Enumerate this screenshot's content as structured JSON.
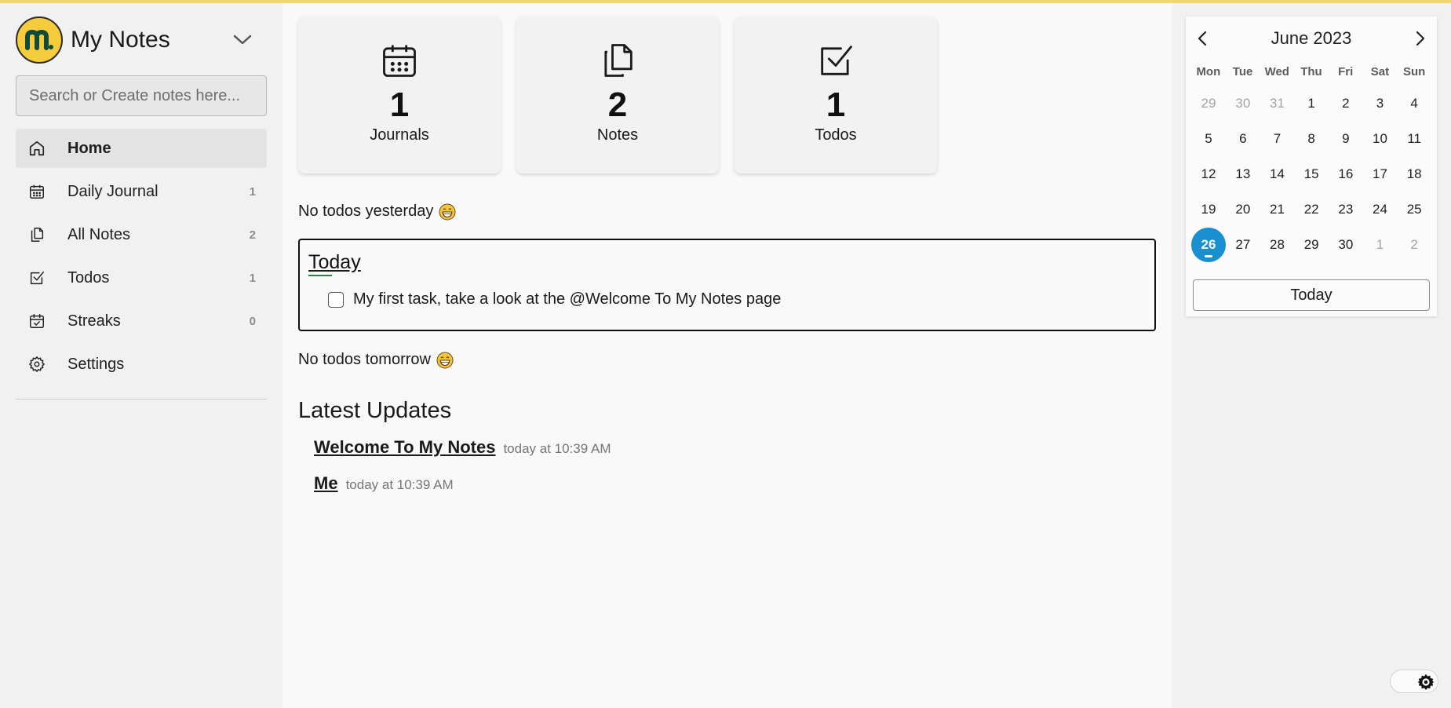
{
  "app": {
    "title": "My Notes",
    "accent_color": "#f5cc3b",
    "highlight_color": "#1a8fcf"
  },
  "search": {
    "placeholder": "Search or Create notes here...",
    "value": ""
  },
  "sidebar": {
    "items": [
      {
        "label": "Home",
        "icon": "home-icon",
        "count": ""
      },
      {
        "label": "Daily Journal",
        "icon": "calendar-icon",
        "count": "1"
      },
      {
        "label": "All Notes",
        "icon": "notes-icon",
        "count": "2"
      },
      {
        "label": "Todos",
        "icon": "checkbox-icon",
        "count": "1"
      },
      {
        "label": "Streaks",
        "icon": "calendar-check-icon",
        "count": "0"
      },
      {
        "label": "Settings",
        "icon": "gear-icon",
        "count": ""
      }
    ]
  },
  "stats": [
    {
      "number": "1",
      "label": "Journals",
      "icon": "calendar-icon"
    },
    {
      "number": "2",
      "label": "Notes",
      "icon": "notes-icon"
    },
    {
      "number": "1",
      "label": "Todos",
      "icon": "checkbox-icon"
    }
  ],
  "todos": {
    "yesterday": "No todos yesterday",
    "today_title": "Today",
    "today_items": [
      {
        "text": "My first task, take a look at the @Welcome To My Notes page",
        "checked": false
      }
    ],
    "tomorrow": "No todos tomorrow"
  },
  "updates": {
    "title": "Latest Updates",
    "items": [
      {
        "title": "Welcome To My Notes",
        "time": "today at 10:39 AM"
      },
      {
        "title": "Me",
        "time": "today at 10:39 AM"
      }
    ]
  },
  "calendar": {
    "month_label": "June 2023",
    "days_of_week": [
      "Mon",
      "Tue",
      "Wed",
      "Thu",
      "Fri",
      "Sat",
      "Sun"
    ],
    "weeks": [
      [
        "29",
        "30",
        "31",
        "1",
        "2",
        "3",
        "4"
      ],
      [
        "5",
        "6",
        "7",
        "8",
        "9",
        "10",
        "11"
      ],
      [
        "12",
        "13",
        "14",
        "15",
        "16",
        "17",
        "18"
      ],
      [
        "19",
        "20",
        "21",
        "22",
        "23",
        "24",
        "25"
      ],
      [
        "26",
        "27",
        "28",
        "29",
        "30",
        "1",
        "2"
      ]
    ],
    "muted_days": [
      [
        0,
        0
      ],
      [
        0,
        1
      ],
      [
        0,
        2
      ],
      [
        4,
        5
      ],
      [
        4,
        6
      ]
    ],
    "selected_day": "26",
    "today_button": "Today"
  }
}
